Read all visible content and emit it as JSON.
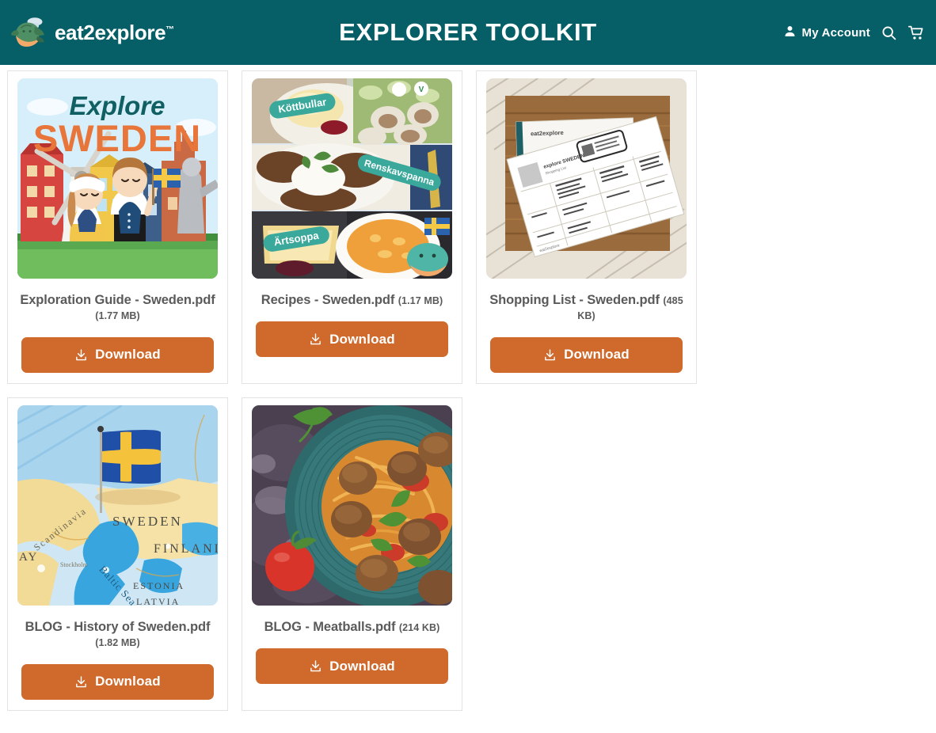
{
  "header": {
    "brand_name": "eat2explore",
    "brand_tm": "™",
    "title": "EXPLORER TOOLKIT",
    "account_label": "My Account",
    "search_icon": "search-icon",
    "cart_icon": "cart-icon",
    "user_icon": "user-icon",
    "background_color": "#065E66",
    "text_color": "#FFFFFF"
  },
  "theme": {
    "accent_orange": "#CF6A2C",
    "teal": "#065E66",
    "caption_gray": "#5A5A5A",
    "card_border": "#E3E3E3",
    "page_background": "#FFFFFF"
  },
  "download_label": "Download",
  "cards": [
    {
      "id": "exploration-guide-sweden",
      "title": "Exploration Guide - Sweden.pdf",
      "size": "(1.77 MB)",
      "thumb": "explore-sweden-cover",
      "thumb_text": {
        "line1": "Explore",
        "line2": "SWEDEN"
      },
      "download_label": "Download"
    },
    {
      "id": "recipes-sweden",
      "title": "Recipes - Sweden.pdf",
      "size": "(1.17 MB)",
      "thumb": "recipes-collage",
      "recipe_labels": [
        "Köttbullar",
        "Renskavspanna",
        "Ärtsoppa"
      ],
      "download_label": "Download"
    },
    {
      "id": "shopping-list-sweden",
      "title": "Shopping List - Sweden.pdf",
      "size": "(485 KB)",
      "thumb": "shopping-list-photo",
      "thumb_text": {
        "brand": "eat2explore",
        "country": "Sweden",
        "word": "expl"
      },
      "download_label": "Download"
    },
    {
      "id": "blog-history-of-sweden",
      "title": "BLOG - History of Sweden.pdf",
      "size": "(1.82 MB)",
      "thumb": "sweden-map-flag",
      "map_labels": [
        "SWEDEN",
        "FINLAND",
        "Scandinavia",
        "Baltic Sea",
        "ESTONIA",
        "LATVIA",
        "Stockholm"
      ],
      "download_label": "Download"
    },
    {
      "id": "blog-meatballs",
      "title": "BLOG - Meatballs.pdf",
      "size": "(214 KB)",
      "thumb": "meatballs-photo",
      "download_label": "Download"
    }
  ]
}
